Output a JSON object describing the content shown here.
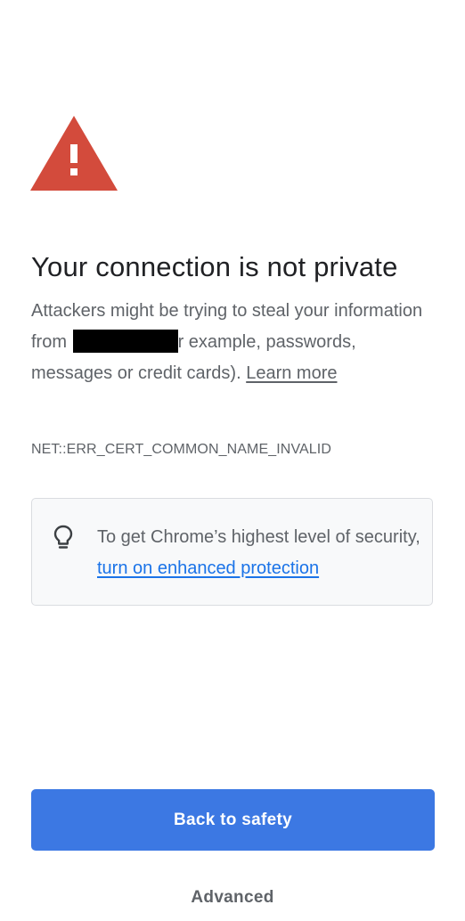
{
  "warning": {
    "icon": "warning-triangle-icon",
    "color": "#d34b3c"
  },
  "title": "Your connection is not private",
  "body": {
    "line_start": "Attackers might be trying to steal your information from",
    "line_end": "r example, passwords, messages or credit cards).",
    "learn_more": "Learn more"
  },
  "error_code": "NET::ERR_CERT_COMMON_NAME_INVALID",
  "info_box": {
    "icon": "lightbulb-icon",
    "text": "To get Chrome’s highest level of security,",
    "link": "turn on enhanced protection"
  },
  "buttons": {
    "primary": "Back to safety",
    "secondary": "Advanced"
  },
  "colors": {
    "primary_button": "#3c78e3",
    "link": "#1a73e8",
    "text": "#5f6368",
    "title": "#202124"
  }
}
